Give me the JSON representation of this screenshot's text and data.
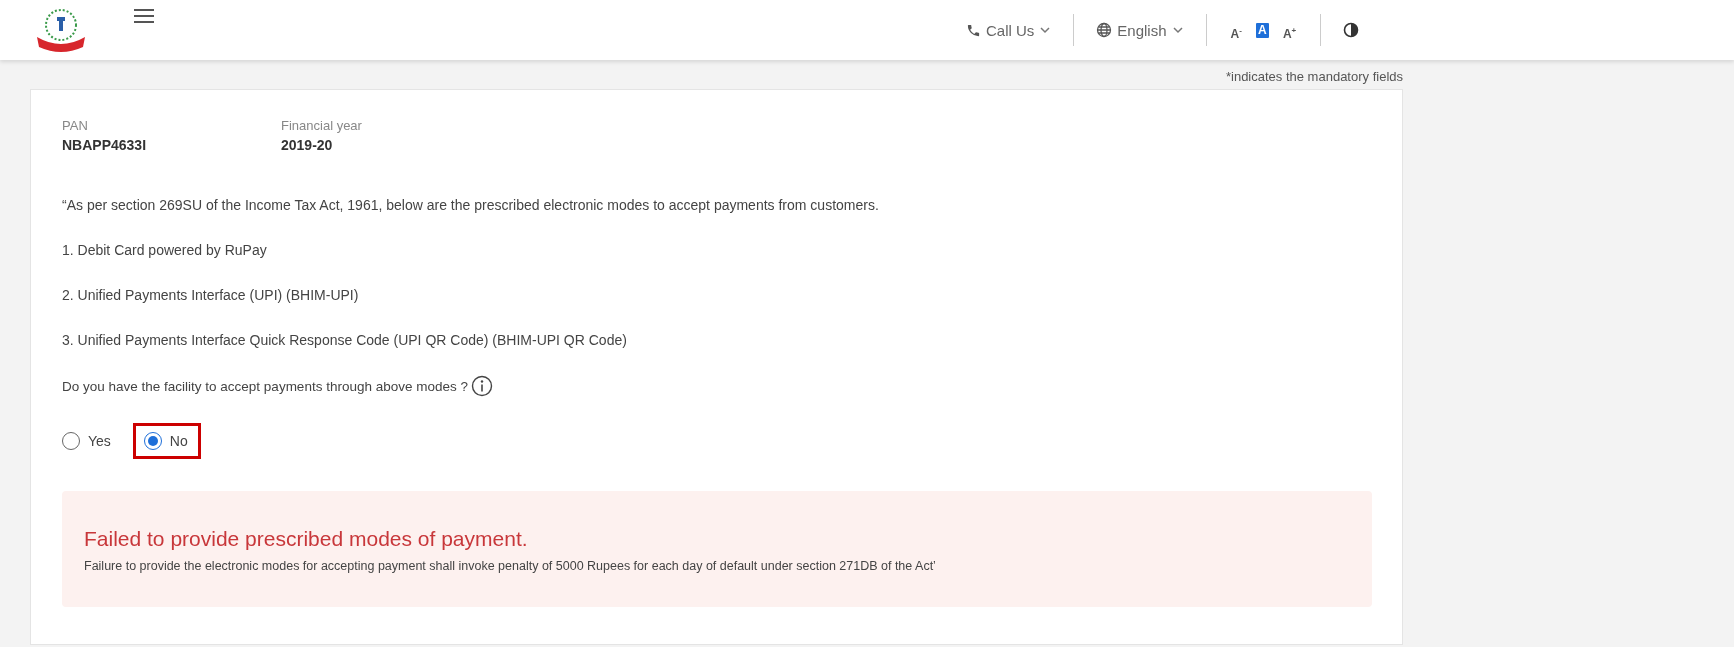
{
  "header": {
    "call_us": "Call Us",
    "language": "English",
    "font_sizes": [
      {
        "label": "A",
        "sup": "-",
        "selected": false
      },
      {
        "label": "A",
        "selected": true
      },
      {
        "label": "A",
        "sup": "+",
        "selected": false
      }
    ]
  },
  "mandatory_note": "*indicates the mandatory fields",
  "fields": [
    {
      "label": "PAN",
      "value": "NBAPP4633I"
    },
    {
      "label": "Financial year",
      "value": "2019-20"
    }
  ],
  "intro": "“As per section 269SU of the Income Tax Act, 1961, below are the prescribed electronic modes to accept payments from customers.",
  "modes": [
    "1. Debit Card powered by RuPay",
    "2. Unified Payments Interface (UPI) (BHIM-UPI)",
    "3. Unified Payments Interface Quick Response Code (UPI QR Code) (BHIM-UPI QR Code)"
  ],
  "question": "Do you have the facility to accept payments through above modes ?",
  "options": [
    {
      "label": "Yes",
      "selected": false,
      "highlighted": false
    },
    {
      "label": "No",
      "selected": true,
      "highlighted": true
    }
  ],
  "alert": {
    "title": "Failed to provide prescribed modes of payment.",
    "message": "Failure to provide the electronic modes for accepting payment shall invoke penalty of 5000 Rupees for each day of default under section 271DB of the Act’"
  }
}
